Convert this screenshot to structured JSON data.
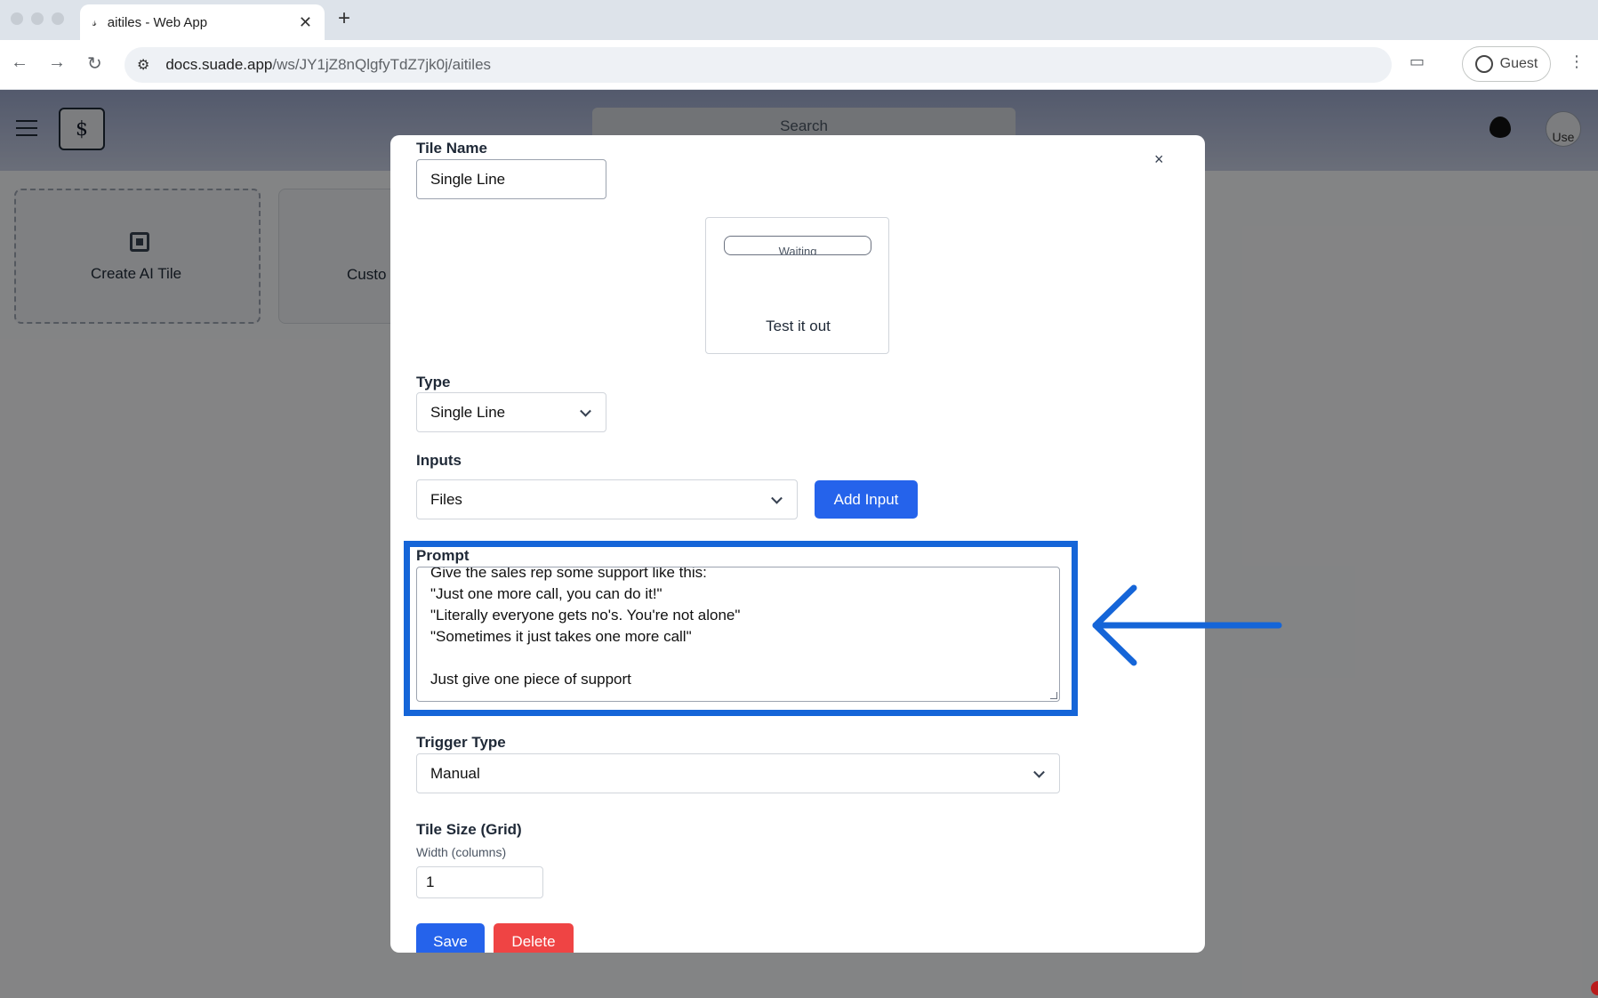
{
  "browser": {
    "tab_title": "aitiles - Web App",
    "tab_favicon": "𝓈",
    "new_tab": "+",
    "tab_close": "✕",
    "url_host": "docs.suade.app",
    "url_path": "/ws/JY1jZ8nQlgfyTdZ7jk0j/aitiles",
    "profile_label": "Guest"
  },
  "app": {
    "search_placeholder": "Search",
    "user_avatar_alt": "Use",
    "cards": {
      "create_label": "Create AI Tile",
      "custom_label": "Custo"
    }
  },
  "modal": {
    "close": "×",
    "tile_name_label": "Tile Name",
    "tile_name_value": "Single Line",
    "preview_status": "Waiting",
    "preview_label": "Test it out",
    "type_label": "Type",
    "type_value": "Single Line",
    "inputs_label": "Inputs",
    "inputs_value": "Files",
    "add_input_label": "Add Input",
    "prompt_label": "Prompt",
    "prompt_value": "Give the sales rep some support like this:\n\"Just one more call, you can do it!\"\n\"Literally everyone gets no's. You're not alone\"\n\"Sometimes it just takes one more call\"\n\nJust give one piece of support",
    "trigger_label": "Trigger Type",
    "trigger_value": "Manual",
    "tile_size_label": "Tile Size (Grid)",
    "width_label": "Width (columns)",
    "width_value": "1",
    "save_label": "Save",
    "delete_label": "Delete"
  },
  "annotation": {
    "color": "#1565d8"
  }
}
